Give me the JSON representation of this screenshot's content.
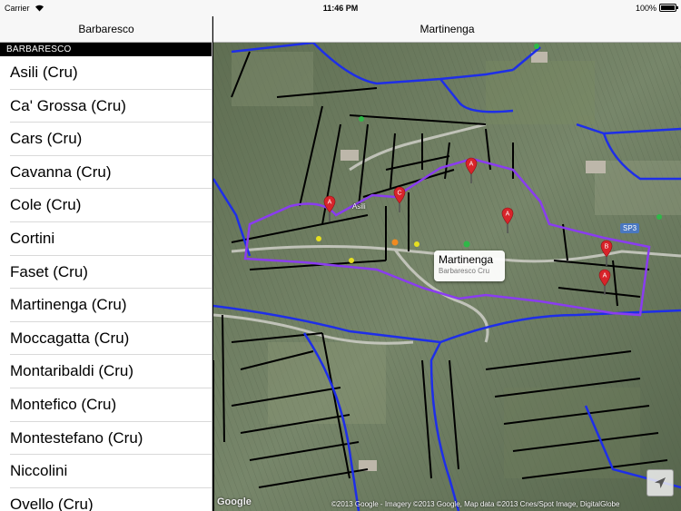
{
  "status_bar": {
    "carrier": "Carrier",
    "time": "11:46 PM",
    "battery": "100%"
  },
  "sidebar": {
    "nav_title": "Barbaresco",
    "section_header": "BARBARESCO",
    "items": [
      "Asili (Cru)",
      "Ca' Grossa (Cru)",
      "Cars (Cru)",
      "Cavanna (Cru)",
      "Cole (Cru)",
      "Cortini",
      "Faset (Cru)",
      "Martinenga (Cru)",
      "Moccagatta (Cru)",
      "Montaribaldi (Cru)",
      "Montefico (Cru)",
      "Montestefano (Cru)",
      "Niccolini",
      "Ovello (Cru)"
    ]
  },
  "map_panel": {
    "nav_title": "Martinenga",
    "callout": {
      "title": "Martinenga",
      "subtitle": "Barbaresco Cru"
    },
    "road_label": "SP3",
    "town_label": "Asili",
    "pin_labels": [
      "A",
      "A",
      "C",
      "A",
      "A",
      "B",
      "A"
    ],
    "google_logo": "Google",
    "attribution": "©2013 Google - Imagery ©2013 Google, Map data ©2013 Cnes/Spot Image, DigitalGlobe",
    "colors": {
      "cru_boundary": "#8a3cf0",
      "commune_boundary": "#1e2ee8",
      "pin": "#d8242a",
      "terrain": "#6d7d5b"
    }
  }
}
